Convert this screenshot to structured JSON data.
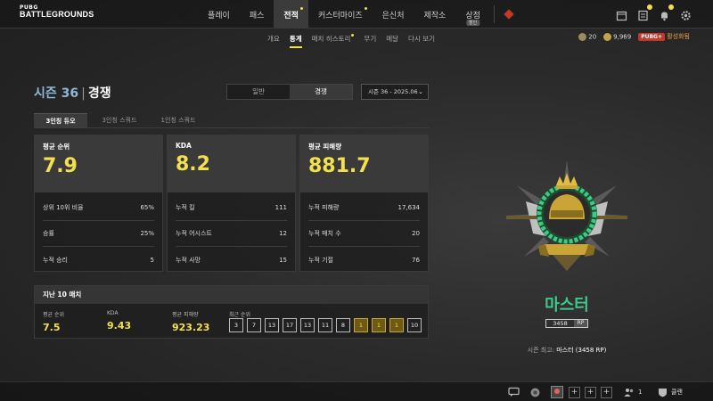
{
  "logo": {
    "line1": "PUBG",
    "line2": "BATTLEGROUNDS"
  },
  "nav": {
    "items": [
      {
        "label": "플레이"
      },
      {
        "label": "패스"
      },
      {
        "label": "전적"
      },
      {
        "label": "커스터마이즈"
      },
      {
        "label": "은신처"
      },
      {
        "label": "제작소"
      },
      {
        "label": "상점",
        "tag": "할인"
      }
    ],
    "active_index": 2
  },
  "subnav": {
    "items": [
      "개요",
      "통계",
      "매치 히스토리",
      "무기",
      "메달",
      "다시 보기"
    ],
    "active_index": 1
  },
  "currency": {
    "g_coin": "20",
    "bp": "9,969",
    "event_label": "PUBG+",
    "event_text": "활성화됨"
  },
  "header": {
    "season": "시즌 36",
    "mode_title": "경쟁",
    "mode_options": [
      "일반",
      "경쟁"
    ],
    "mode_active": 1,
    "season_select": "시즌 36 - 2025.06"
  },
  "squad_tabs": {
    "items": [
      "3인칭 듀오",
      "3인칭 스쿼드",
      "1인칭 스쿼드"
    ],
    "active_index": 0
  },
  "cards": [
    {
      "label": "평균 순위",
      "value": "7.9",
      "rows": [
        {
          "k": "상위 10위 비율",
          "v": "65%"
        },
        {
          "k": "승률",
          "v": "25%"
        },
        {
          "k": "누적 승리",
          "v": "5"
        }
      ]
    },
    {
      "label": "KDA",
      "value": "8.2",
      "rows": [
        {
          "k": "누적 킬",
          "v": "111"
        },
        {
          "k": "누적 어시스트",
          "v": "12"
        },
        {
          "k": "누적 사망",
          "v": "15"
        }
      ]
    },
    {
      "label": "평균 피해량",
      "value": "881.7",
      "rows": [
        {
          "k": "누적 피해량",
          "v": "17,634"
        },
        {
          "k": "누적 매치 수",
          "v": "20"
        },
        {
          "k": "누적 기절",
          "v": "76"
        }
      ]
    }
  ],
  "last10": {
    "title": "지난 10 매치",
    "avg_rank_label": "평균 순위",
    "avg_rank": "7.5",
    "kda_label": "KDA",
    "kda": "9.43",
    "avg_dmg_label": "평균 피해량",
    "avg_dmg": "923.23",
    "recent_label": "최근 순위",
    "ranks": [
      "3",
      "7",
      "13",
      "17",
      "13",
      "11",
      "8",
      "1",
      "1",
      "1",
      "10"
    ]
  },
  "tier": {
    "name": "마스터",
    "rp": "3458",
    "rp_unit": "RP",
    "badge_text": "PUBG",
    "season_best_label": "시즌 최고:",
    "season_best_value": "마스터 (3458 RP)"
  },
  "bottom": {
    "party_count": "1",
    "clan_label": "클랜"
  },
  "colors": {
    "accent_yellow": "#f4e04d",
    "tier_green": "#3ec98a",
    "alert_red": "#c0392b"
  }
}
